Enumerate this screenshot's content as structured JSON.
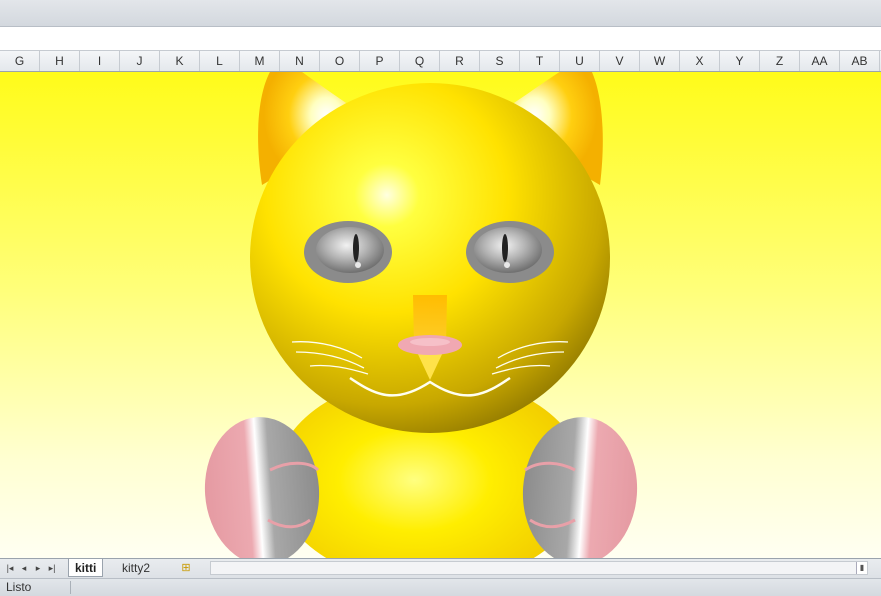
{
  "columns": [
    "G",
    "H",
    "I",
    "J",
    "K",
    "L",
    "M",
    "N",
    "O",
    "P",
    "Q",
    "R",
    "S",
    "T",
    "U",
    "V",
    "W",
    "X",
    "Y",
    "Z",
    "AA",
    "AB"
  ],
  "sheet_tabs": [
    {
      "label": "kitti",
      "active": true
    },
    {
      "label": "kitty2",
      "active": false
    }
  ],
  "status": {
    "text": "Listo"
  },
  "nav_icons": [
    "first-sheet-icon",
    "prev-sheet-icon",
    "next-sheet-icon",
    "last-sheet-icon"
  ],
  "colors": {
    "cat_yellow": "#ffd700",
    "ear_orange": "#ffbe00",
    "eye_grey": "#8a8a8a",
    "nose_pink": "#f3a6b0",
    "paw_pink": "#e8a0a8",
    "paw_grey": "#9d9d9d"
  }
}
